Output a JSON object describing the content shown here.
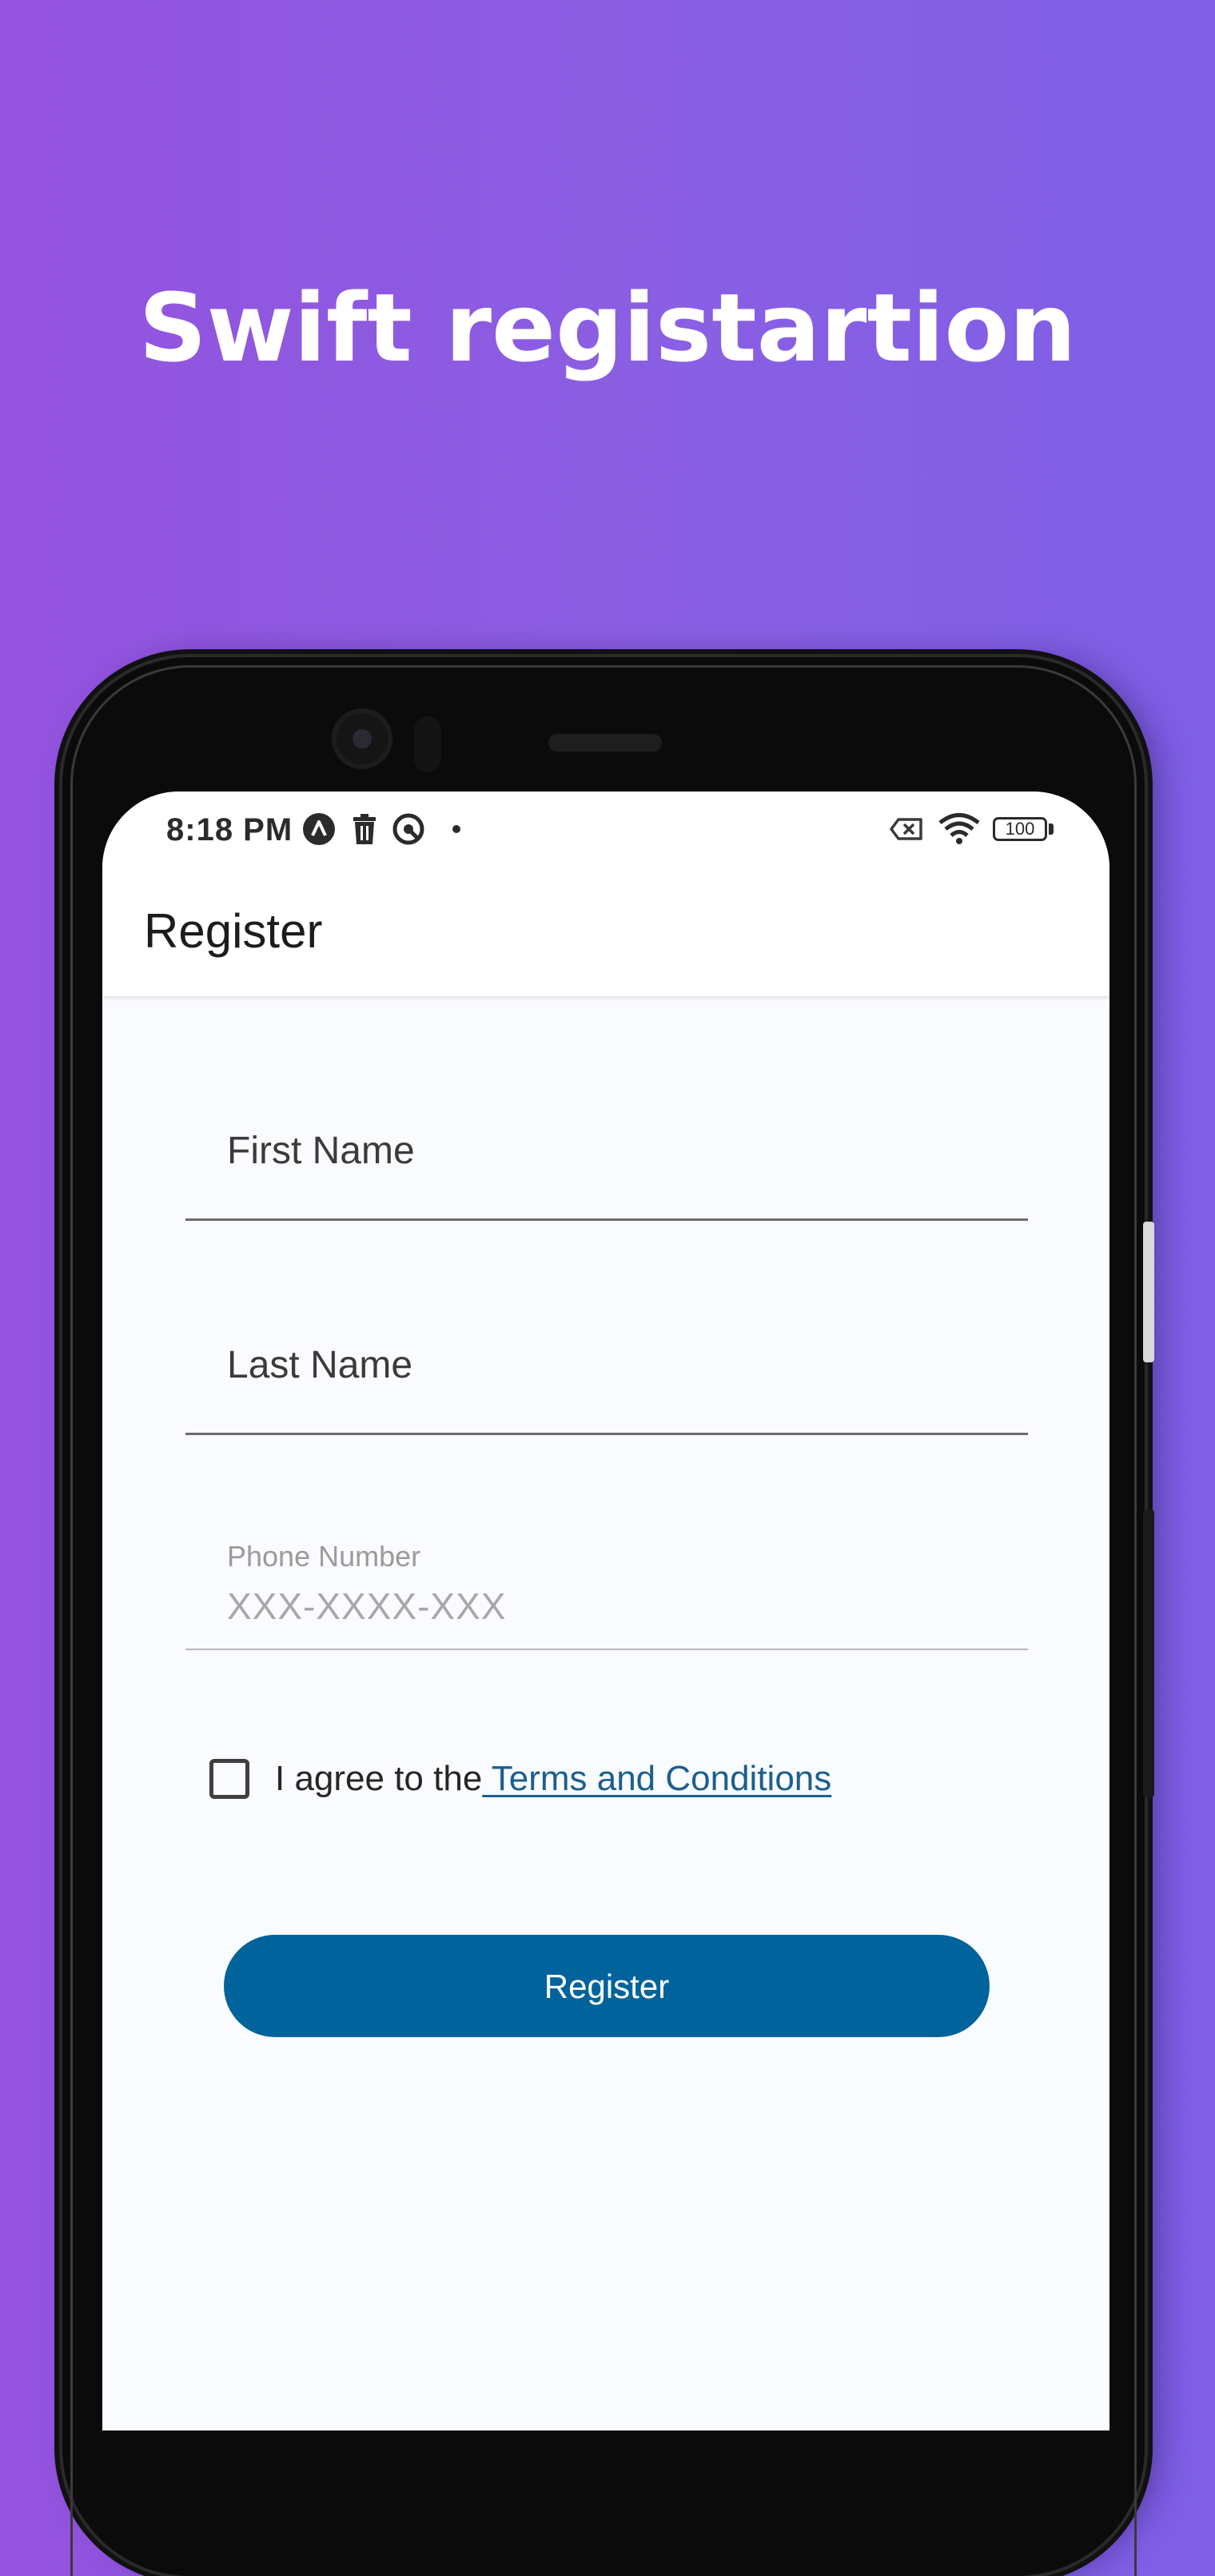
{
  "headline": "Swift registartion",
  "status_bar": {
    "time": "8:18 PM",
    "battery": "100",
    "icons": [
      "drive-icon",
      "trash-icon",
      "sync-icon",
      "dot-icon",
      "sim-off-icon",
      "wifi-icon",
      "battery-icon"
    ]
  },
  "app_bar": {
    "title": "Register"
  },
  "form": {
    "first_name_label": "First Name",
    "last_name_label": "Last Name",
    "phone_label": "Phone Number",
    "phone_placeholder": "XXX-XXXX-XXX",
    "terms_prefix": "I agree to the",
    "terms_link": " Terms and Conditions",
    "terms_checked": false,
    "submit_label": "Register"
  },
  "colors": {
    "background_start": "#9452DF",
    "background_end": "#7E5FE6",
    "primary": "#00639B",
    "link": "#1B5F8E",
    "screen_bg": "#FAFBFE"
  }
}
